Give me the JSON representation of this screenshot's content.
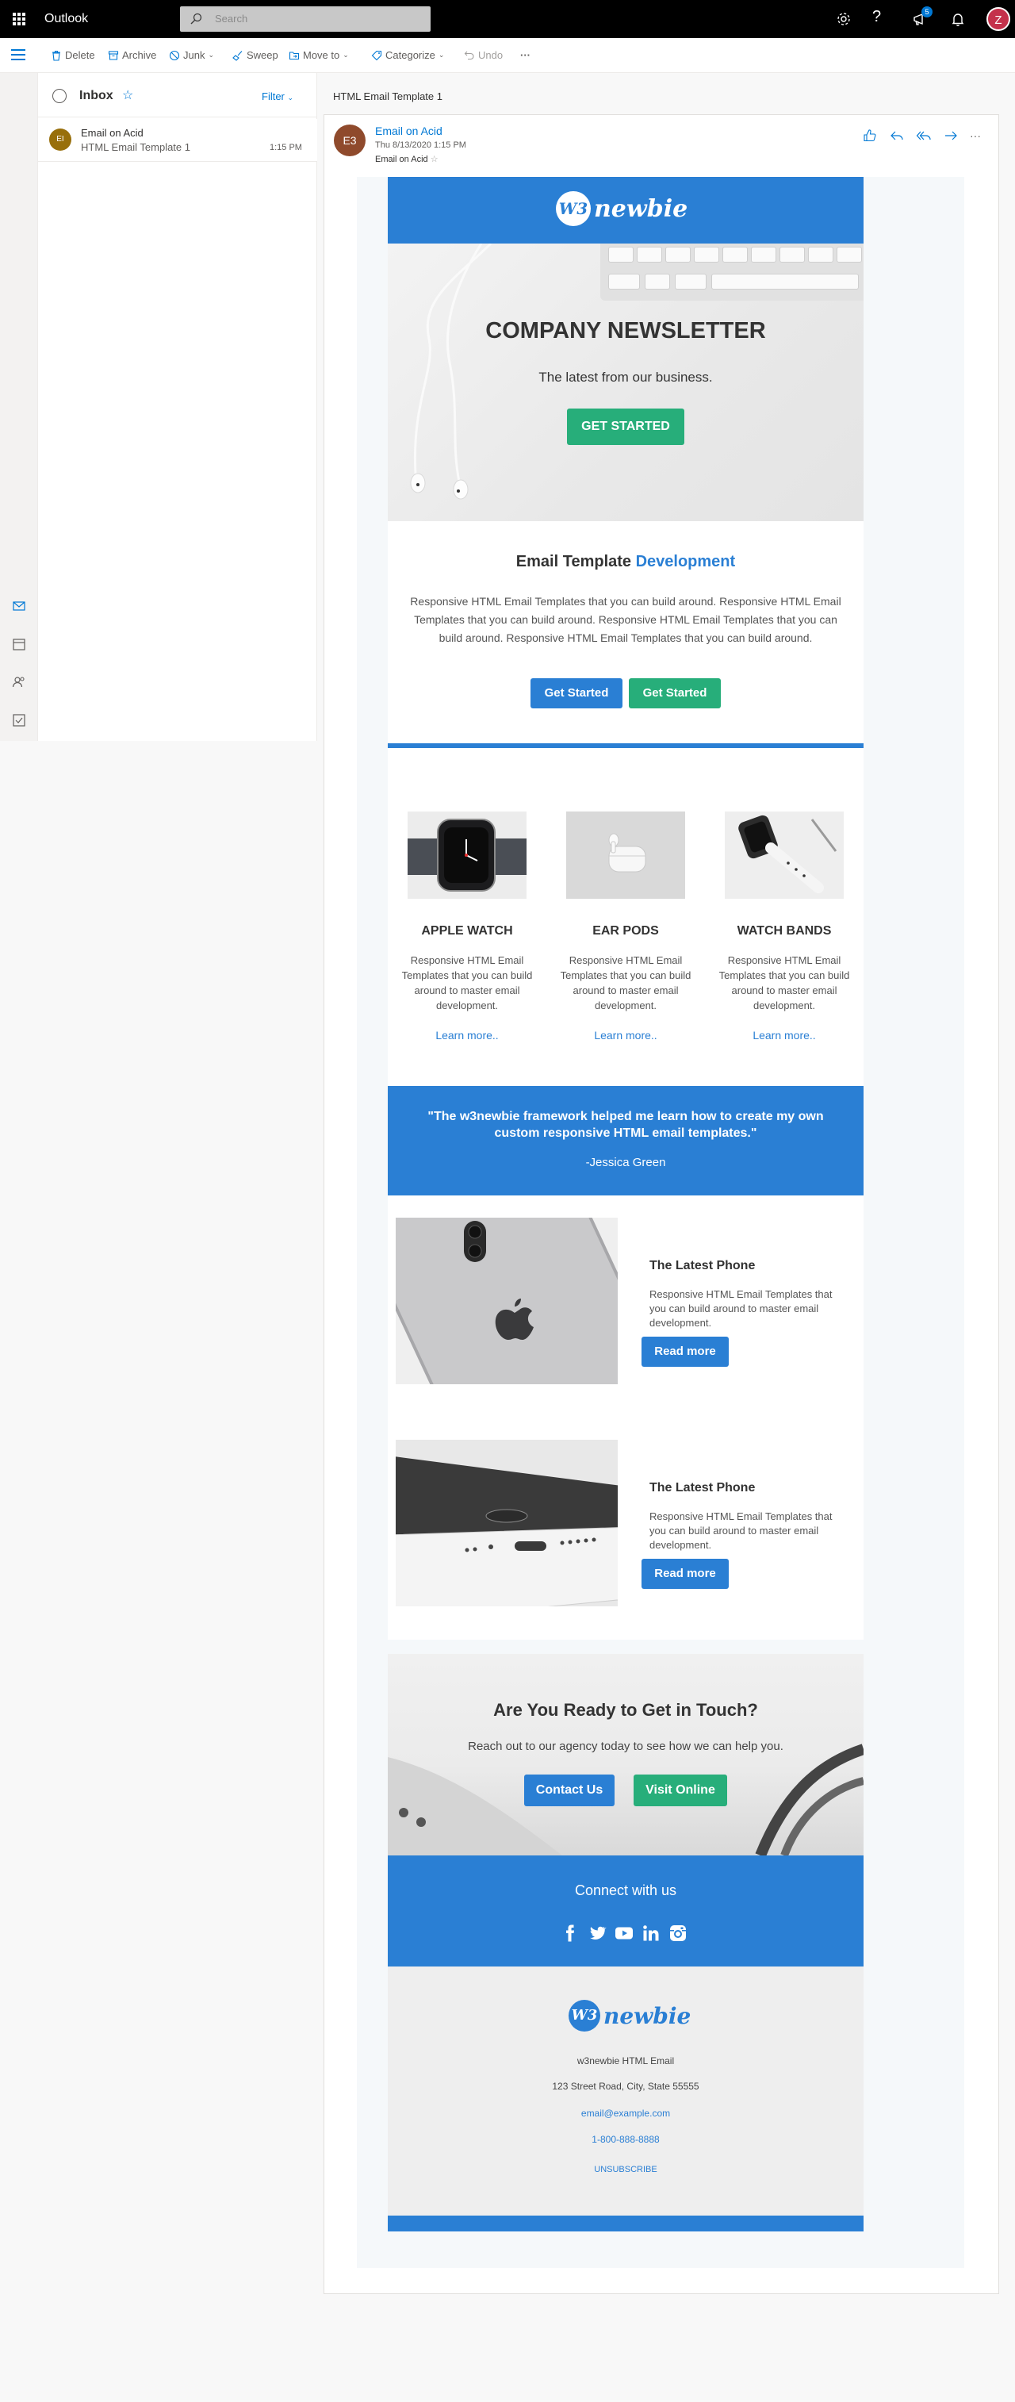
{
  "app": {
    "title": "Outlook",
    "search_placeholder": "Search",
    "help": "?",
    "notification_count": "5",
    "user_initial": "Z"
  },
  "toolbar": {
    "delete": "Delete",
    "archive": "Archive",
    "junk": "Junk",
    "sweep": "Sweep",
    "move_to": "Move to",
    "categorize": "Categorize",
    "undo": "Undo",
    "more": "···"
  },
  "folder": {
    "title": "Inbox",
    "filter": "Filter"
  },
  "mail_list": [
    {
      "initials": "EI",
      "sender": "Email on Acid",
      "subject": "HTML Email Template 1",
      "time": "1:15 PM"
    }
  ],
  "reading": {
    "subject": "HTML Email Template 1",
    "sender_initials": "E3",
    "sender_name": "Email on Acid",
    "date": "Thu 8/13/2020 1:15 PM",
    "to": "Email on Acid"
  },
  "email": {
    "logo_mark": "W3",
    "logo_text": "newbie",
    "hero": {
      "title": "COMPANY NEWSLETTER",
      "subtitle": "The latest from our business.",
      "button": "GET STARTED"
    },
    "intro": {
      "title_plain": "Email Template",
      "title_accent": "Development",
      "text": "Responsive HTML Email Templates that you can build around. Responsive HTML Email Templates that you can build around. Responsive HTML Email Templates that you can build around. Responsive HTML Email Templates that you can build around.",
      "button_1": "Get Started",
      "button_2": "Get Started"
    },
    "products": [
      {
        "name": "APPLE WATCH",
        "text": "Responsive HTML Email Templates that you can build around to master email development.",
        "link": "Learn more.."
      },
      {
        "name": "EAR PODS",
        "text": "Responsive HTML Email Templates that you can build around to master email development.",
        "link": "Learn more.."
      },
      {
        "name": "WATCH BANDS",
        "text": "Responsive HTML Email Templates that you can build around to master email development.",
        "link": "Learn more.."
      }
    ],
    "quote": {
      "text": "\"The w3newbie framework helped me learn how to create my own custom responsive HTML email templates.\"",
      "author": "-Jessica Green"
    },
    "features": [
      {
        "title": "The Latest Phone",
        "text": "Responsive HTML Email Templates that you can build around to master email development.",
        "button": "Read more"
      },
      {
        "title": "The Latest Phone",
        "text": "Responsive HTML Email Templates that you can build around to master email development.",
        "button": "Read more"
      }
    ],
    "contact": {
      "title": "Are You Ready to Get in Touch?",
      "subtitle": "Reach out to our agency today to see how we can help you.",
      "button_1": "Contact Us",
      "button_2": "Visit Online"
    },
    "social": {
      "title": "Connect with us",
      "icons": [
        "facebook-icon",
        "twitter-icon",
        "youtube-icon",
        "linkedin-icon",
        "instagram-icon"
      ]
    },
    "footer": {
      "company": "w3newbie HTML Email",
      "address": "123 Street Road, City, State 55555",
      "email": "email@example.com",
      "phone": "1-800-888-8888",
      "unsubscribe": "UNSUBSCRIBE"
    }
  },
  "colors": {
    "brand_blue": "#2a7fd4",
    "brand_green": "#27ae7a",
    "outlook_blue": "#0078d4"
  }
}
